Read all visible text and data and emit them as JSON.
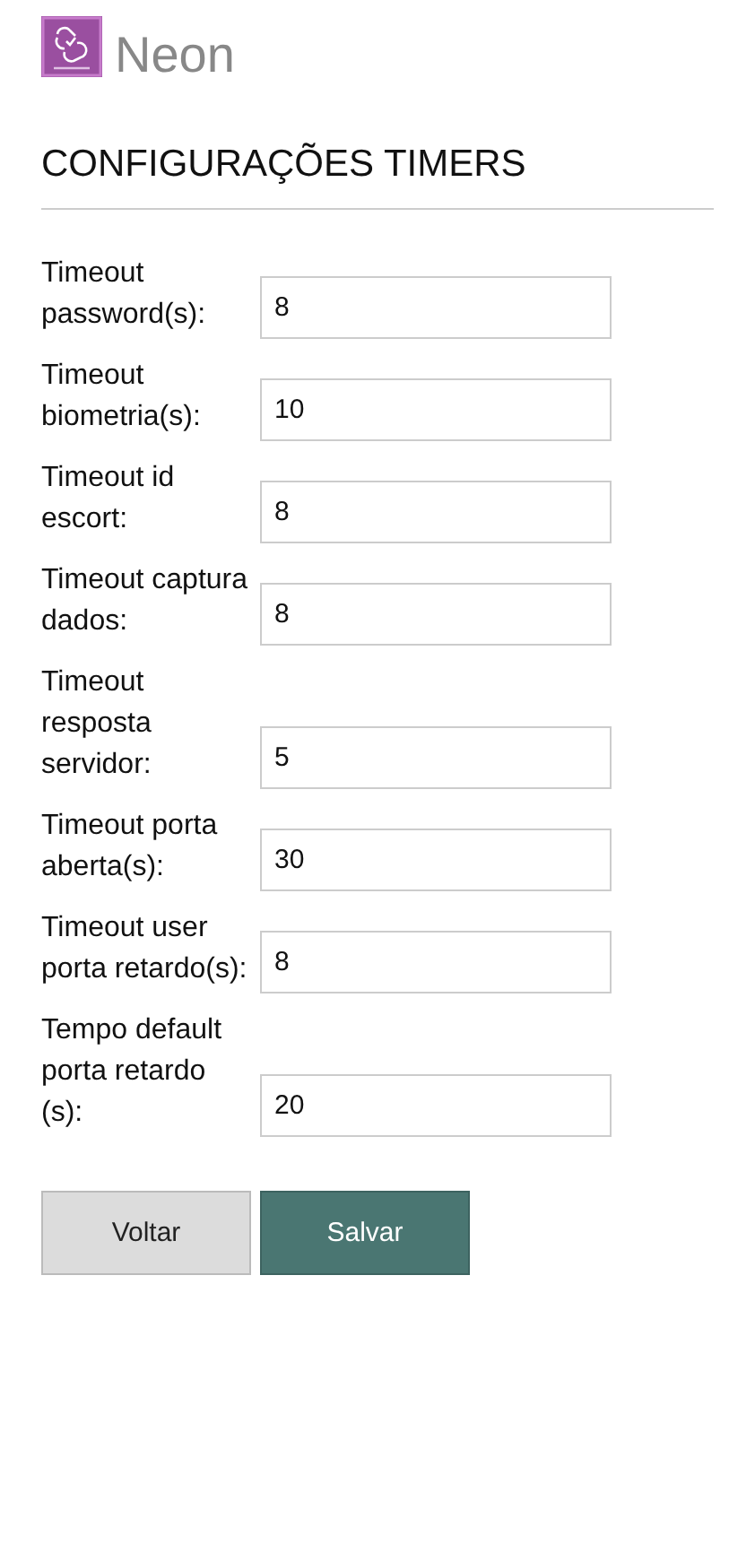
{
  "brand": {
    "name": "Neon"
  },
  "title": "CONFIGURAÇÕES TIMERS",
  "fields": [
    {
      "label": "Timeout password(s):",
      "value": "8"
    },
    {
      "label": "Timeout biometria(s):",
      "value": "10"
    },
    {
      "label": "Timeout id escort:",
      "value": "8"
    },
    {
      "label": "Timeout captura dados:",
      "value": "8"
    },
    {
      "label": "Timeout resposta servidor:",
      "value": "5"
    },
    {
      "label": "Timeout porta aberta(s):",
      "value": "30"
    },
    {
      "label": "Timeout user porta retardo(s):",
      "value": "8"
    },
    {
      "label": "Tempo default porta retardo (s):",
      "value": "20"
    }
  ],
  "buttons": [
    {
      "label": "Voltar",
      "kind": "secondary"
    },
    {
      "label": "Salvar",
      "kind": "primary"
    }
  ]
}
